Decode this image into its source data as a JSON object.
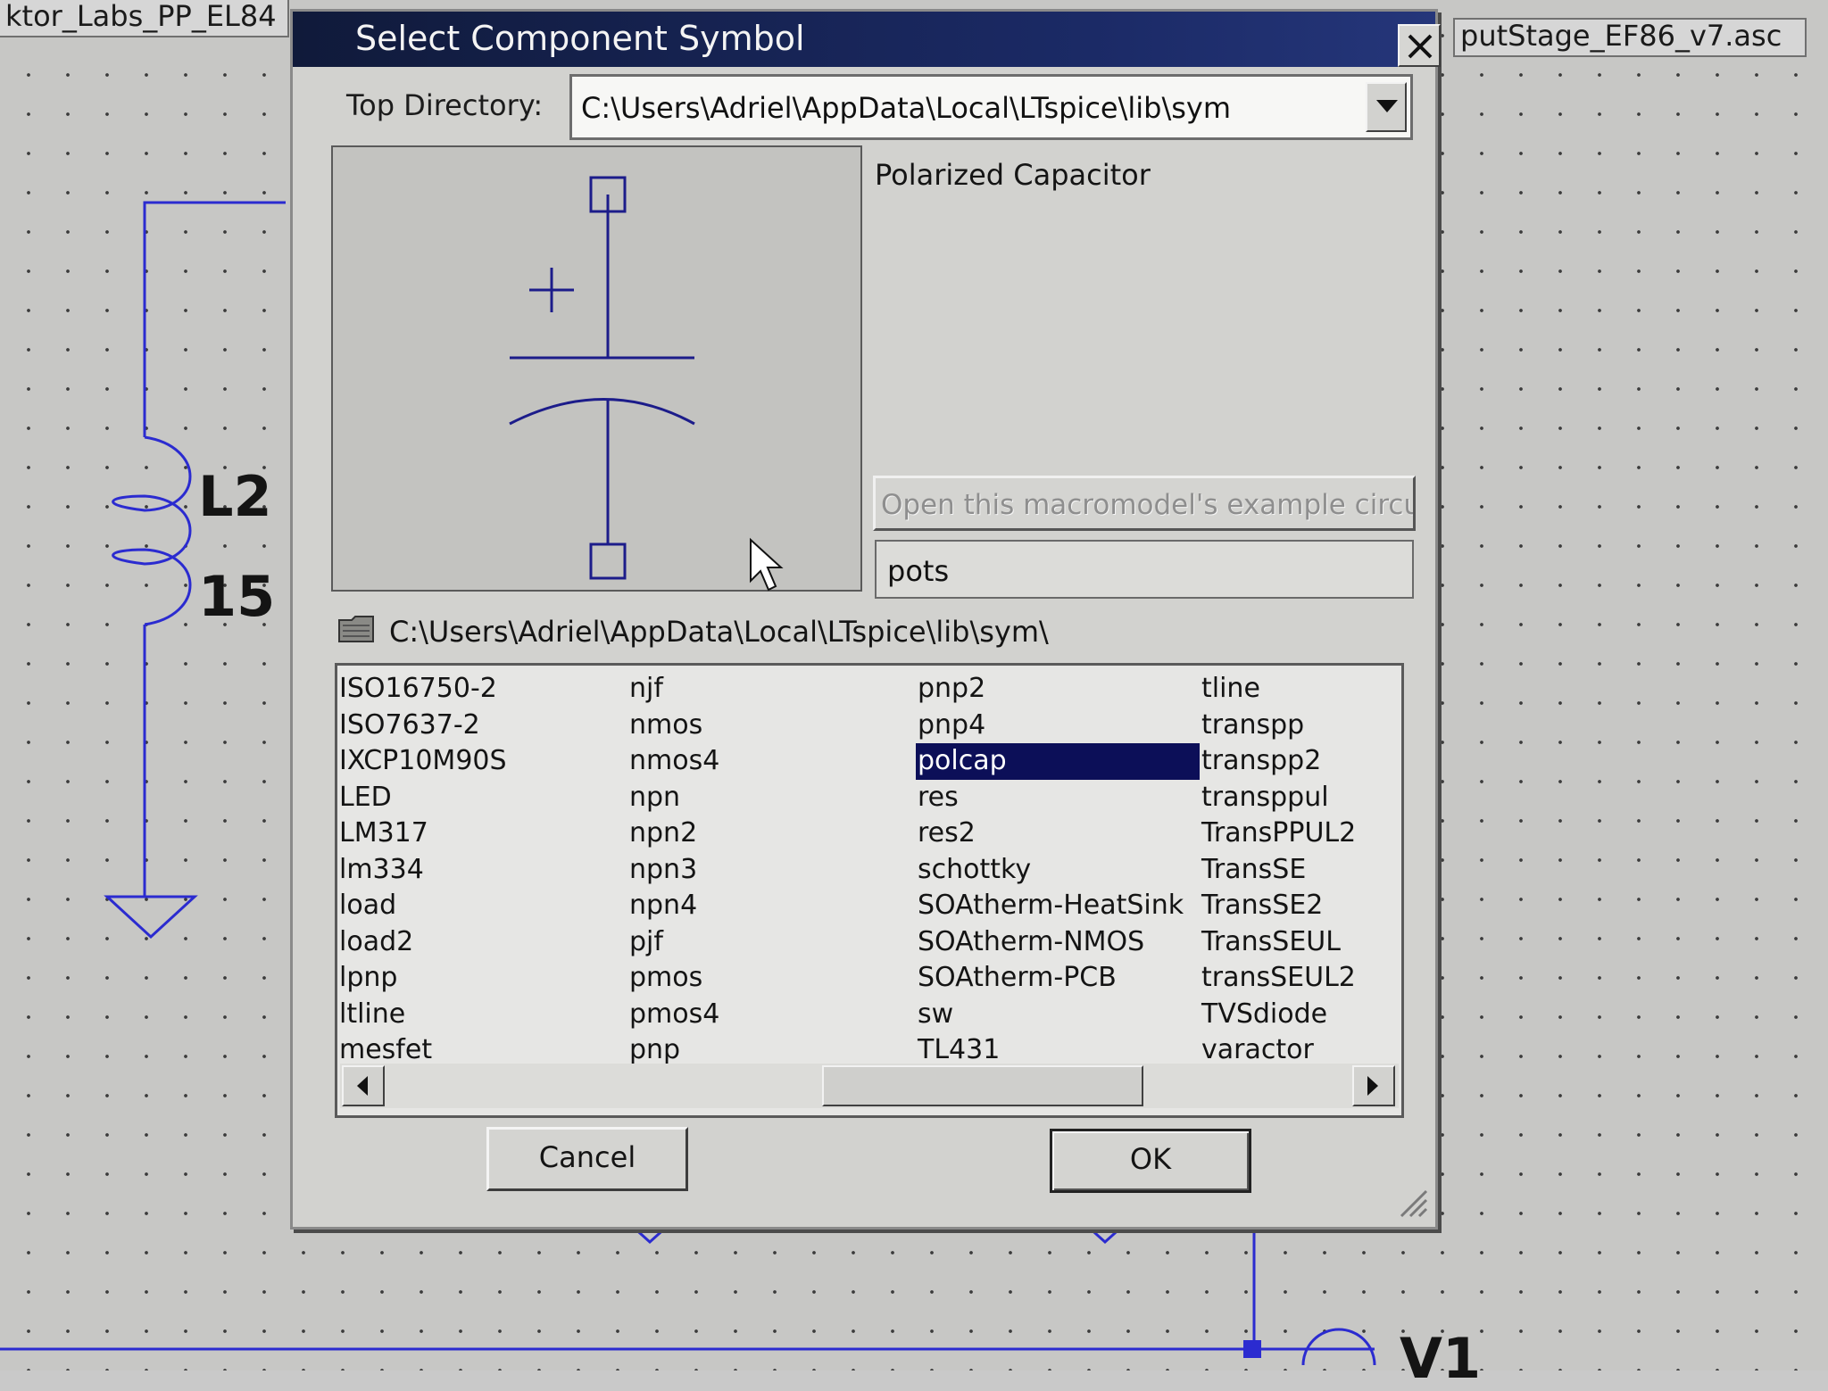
{
  "background": {
    "left_tab_title": "ktor_Labs_PP_EL84",
    "right_tab_title": "putStage_EF86_v7.asc",
    "labels": {
      "inductor_name": "L2",
      "inductor_value": "15",
      "source_name": "V1"
    }
  },
  "dialog": {
    "title": "Select Component Symbol",
    "top_directory_label": "Top Directory:",
    "top_directory_value": "C:\\Users\\Adriel\\AppData\\Local\\LTspice\\lib\\sym",
    "component_description": "Polarized Capacitor",
    "example_button_label": "Open this macromodel's example circuit",
    "search_value": "pots",
    "current_path": "C:\\Users\\Adriel\\AppData\\Local\\LTspice\\lib\\sym\\",
    "columns": [
      [
        "ISO16750-2",
        "ISO7637-2",
        "IXCP10M90S",
        "LED",
        "LM317",
        "lm334",
        "load",
        "load2",
        "lpnp",
        "ltline",
        "mesfet"
      ],
      [
        "njf",
        "nmos",
        "nmos4",
        "npn",
        "npn2",
        "npn3",
        "npn4",
        "pjf",
        "pmos",
        "pmos4",
        "pnp"
      ],
      [
        "pnp2",
        "pnp4",
        "polcap",
        "res",
        "res2",
        "schottky",
        "SOAtherm-HeatSink",
        "SOAtherm-NMOS",
        "SOAtherm-PCB",
        "sw",
        "TL431"
      ],
      [
        "tline",
        "transpp",
        "transpp2",
        "transppul",
        "TransPPUL2",
        "TransSE",
        "TransSE2",
        "TransSEUL",
        "transSEUL2",
        "TVSdiode",
        "varactor"
      ]
    ],
    "selected_item": "polcap",
    "cancel_label": "Cancel",
    "ok_label": "OK"
  },
  "icons": {
    "close": "close-icon",
    "dropdown": "chevron-down-icon",
    "folder": "folder-icon",
    "scroll_left": "arrow-left-icon",
    "scroll_right": "arrow-right-icon",
    "resize": "resize-grip-icon"
  },
  "colors": {
    "title_bar": "#1b2a66",
    "selection": "#0c0f58",
    "wire": "#2b2bd0",
    "symbol": "#1c1c8a"
  }
}
